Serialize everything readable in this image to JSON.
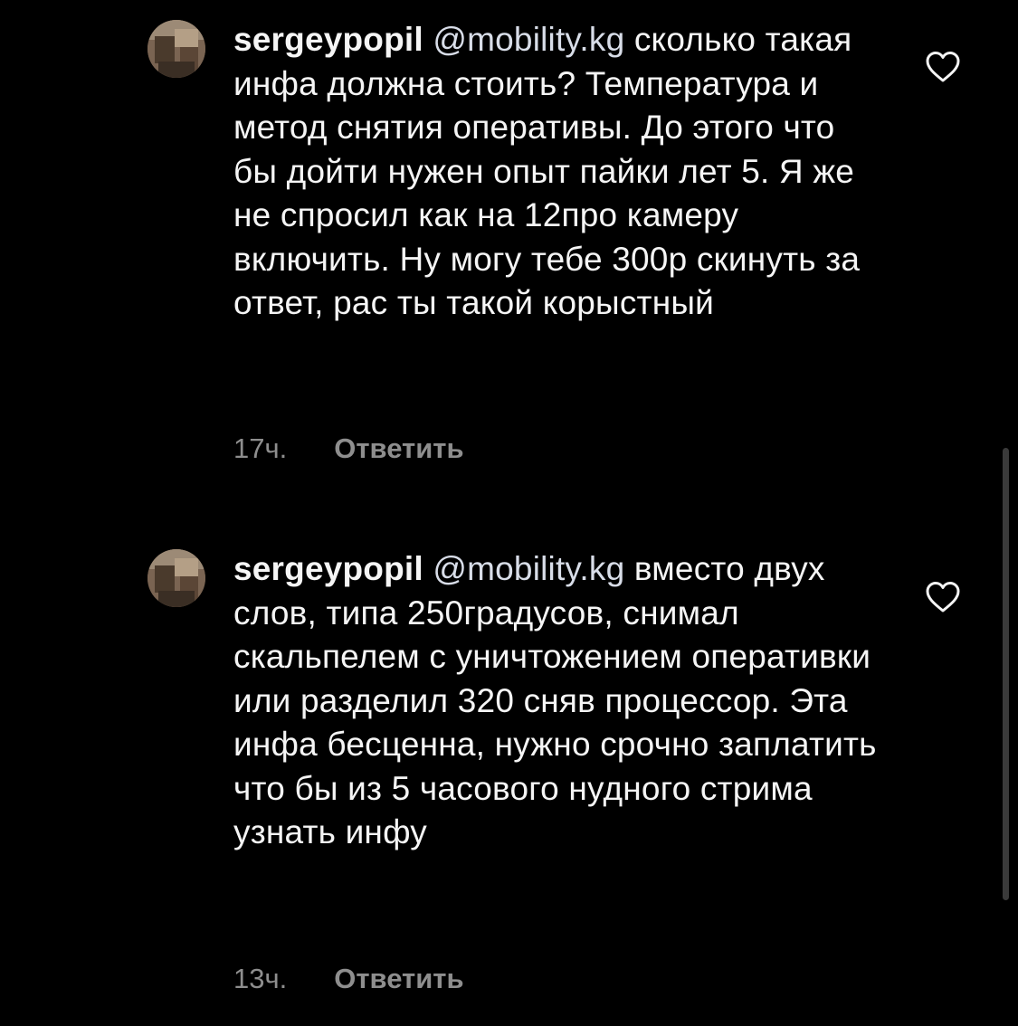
{
  "comments": [
    {
      "username": "sergeypopil",
      "mention": "@mobility.kg",
      "text": "сколько такая инфа должна стоить? Температура и метод снятия оперативы. До этого что бы дойти нужен опыт пайки лет 5. Я же не спросил как на 12про камеру включить.  Ну могу тебе 300р скинуть за ответ, рас ты такой корыстный",
      "time": "17ч.",
      "reply_label": "Ответить"
    },
    {
      "username": "sergeypopil",
      "mention": "@mobility.kg",
      "text": "вместо двух слов, типа 250градусов, снимал скальпелем с уничтожением оперативки или разделил 320 сняв процессор. Эта инфа бесценна, нужно срочно заплатить что бы из 5 часового нудного стрима узнать инфу",
      "time": "13ч.",
      "reply_label": "Ответить"
    }
  ],
  "icons": {
    "like": "heart-outline-icon",
    "avatar": "user-avatar-photo"
  },
  "colors": {
    "background": "#000000",
    "text": "#f5f5f5",
    "meta": "#8e8e8e"
  }
}
